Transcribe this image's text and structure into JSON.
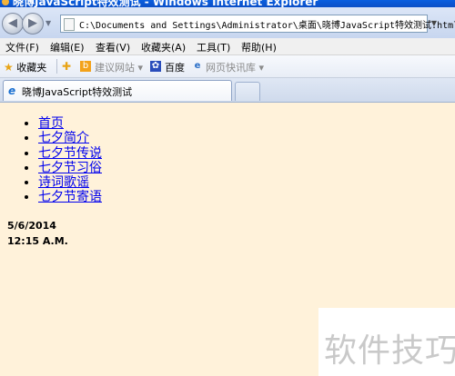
{
  "window": {
    "title": "晓博JavaScript特效测试 - Windows Internet Explorer"
  },
  "address_bar": {
    "url": "C:\\Documents and Settings\\Administrator\\桌面\\晓博JavaScript特效测试.html"
  },
  "menu": [
    "文件(F)",
    "编辑(E)",
    "查看(V)",
    "收藏夹(A)",
    "工具(T)",
    "帮助(H)"
  ],
  "favorites_bar": {
    "favorites_label": "收藏夹",
    "suggested_sites": "建议网站",
    "baidu": "百度",
    "web_slice": "网页快讯库"
  },
  "tab": {
    "label": "晓博JavaScript特效测试"
  },
  "page": {
    "nav_items": [
      "首页",
      "七夕简介",
      "七夕节传说",
      "七夕节习俗",
      "诗词歌谣",
      "七夕节寄语"
    ],
    "date": "5/6/2014",
    "time": "12:15 A.M."
  },
  "watermark": {
    "text": "软件技巧"
  },
  "colors": {
    "content_background": "#FFF2DA",
    "link": "#0000EE",
    "title_bar": "#0A5FE0"
  }
}
